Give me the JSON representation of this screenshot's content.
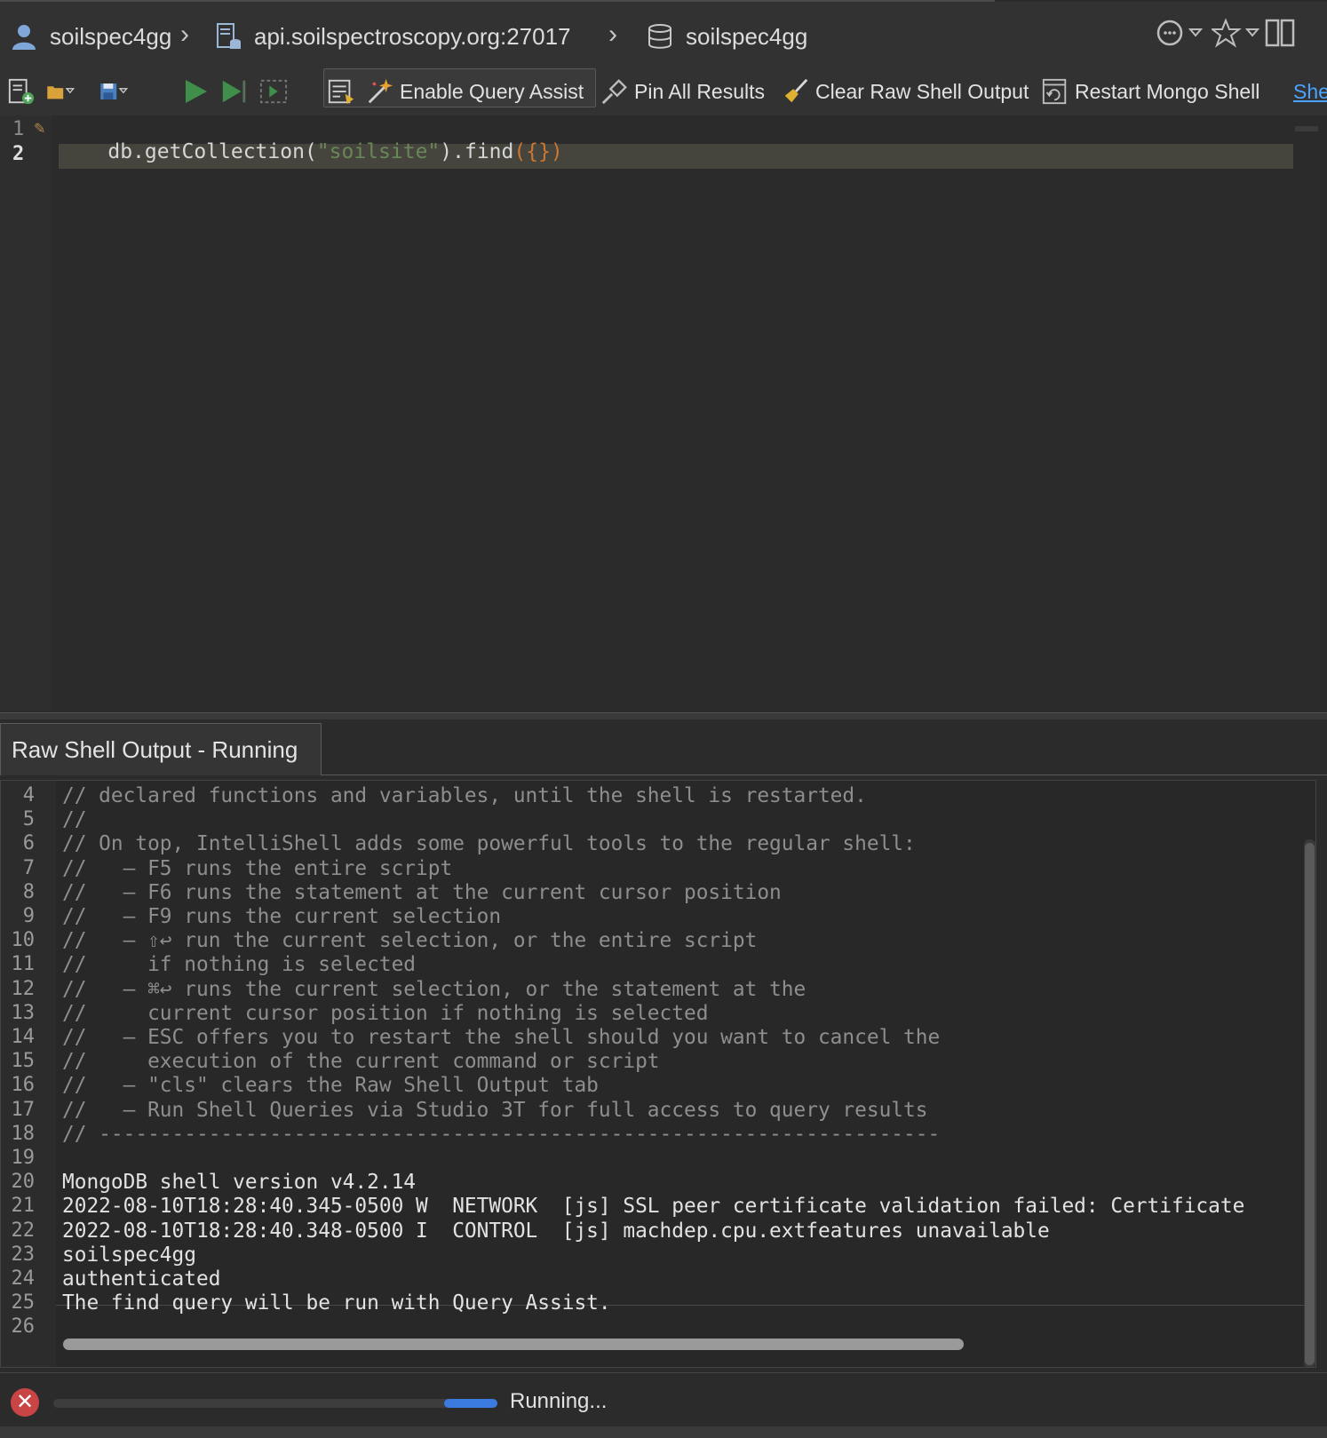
{
  "breadcrumb": {
    "user": "soilspec4gg",
    "server": "api.soilspectroscopy.org:27017",
    "database": "soilspec4gg"
  },
  "toolbar": {
    "enable_query_assist": "Enable Query Assist",
    "pin_all_results": "Pin All Results",
    "clear_raw_shell_output": "Clear Raw Shell Output",
    "restart_mongo_shell": "Restart Mongo Shell",
    "cutoff_link": "She"
  },
  "editor": {
    "lines": [
      {
        "num": "1",
        "parts": [
          "db.getCollection(",
          "\"soilsite\"",
          ").find",
          "({})"
        ]
      },
      {
        "num": "2",
        "parts": []
      }
    ]
  },
  "output_panel": {
    "tab_label": "Raw Shell Output - Running",
    "lines": [
      {
        "num": "4",
        "text": "// declared functions and variables, until the shell is restarted."
      },
      {
        "num": "5",
        "text": "//"
      },
      {
        "num": "6",
        "text": "// On top, IntelliShell adds some powerful tools to the regular shell:"
      },
      {
        "num": "7",
        "text": "//   – F5 runs the entire script"
      },
      {
        "num": "8",
        "text": "//   – F6 runs the statement at the current cursor position"
      },
      {
        "num": "9",
        "text": "//   – F9 runs the current selection"
      },
      {
        "num": "10",
        "text": "//   – ⇧↩ run the current selection, or the entire script"
      },
      {
        "num": "11",
        "text": "//     if nothing is selected"
      },
      {
        "num": "12",
        "text": "//   – ⌘↩ runs the current selection, or the statement at the"
      },
      {
        "num": "13",
        "text": "//     current cursor position if nothing is selected"
      },
      {
        "num": "14",
        "text": "//   – ESC offers you to restart the shell should you want to cancel the"
      },
      {
        "num": "15",
        "text": "//     execution of the current command or script"
      },
      {
        "num": "16",
        "text": "//   – \"cls\" clears the Raw Shell Output tab"
      },
      {
        "num": "17",
        "text": "//   – Run Shell Queries via Studio 3T for full access to query results"
      },
      {
        "num": "18",
        "text": "// ---------------------------------------------------------------------"
      },
      {
        "num": "19",
        "text": ""
      },
      {
        "num": "20",
        "text": "MongoDB shell version v4.2.14"
      },
      {
        "num": "21",
        "text": "2022-08-10T18:28:40.345-0500 W  NETWORK  [js] SSL peer certificate validation failed: Certificate"
      },
      {
        "num": "22",
        "text": "2022-08-10T18:28:40.348-0500 I  CONTROL  [js] machdep.cpu.extfeatures unavailable"
      },
      {
        "num": "23",
        "text": "soilspec4gg"
      },
      {
        "num": "24",
        "text": "authenticated"
      },
      {
        "num": "25",
        "text": "The find query will be run with Query Assist."
      },
      {
        "num": "26",
        "text": ""
      }
    ]
  },
  "status": {
    "text": "Running...",
    "progress": 0.12
  },
  "colors": {
    "background": "#2b2b2b",
    "string": "#6a8759",
    "bracket": "#cc7832",
    "comment": "#8e8e8e",
    "plain": "#d6d6d6",
    "accent_link": "#4aa3ff",
    "progress": "#3b7be0",
    "stop": "#c94545"
  },
  "icons": [
    "user-icon",
    "server-icon",
    "database-icon",
    "history-icon",
    "favorite-star-icon",
    "layout-icon",
    "new-script-icon",
    "open-folder-icon",
    "save-icon",
    "run-icon",
    "run-statement-icon",
    "run-selection-icon",
    "format-icon",
    "magic-wand-icon",
    "pin-icon",
    "broom-icon",
    "restart-icon",
    "stop-icon"
  ]
}
